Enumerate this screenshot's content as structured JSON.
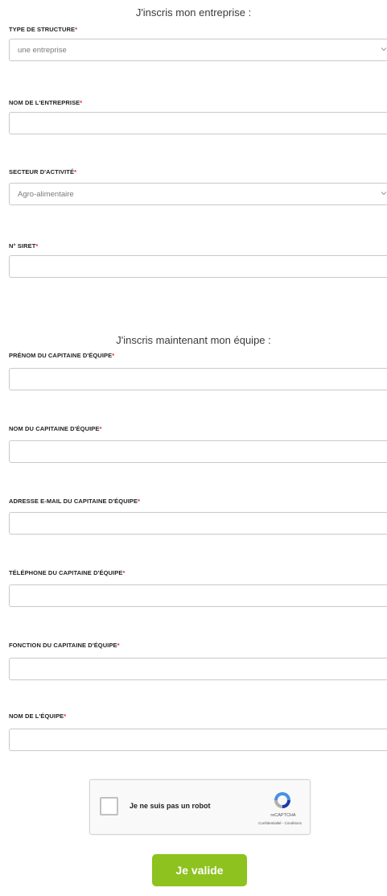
{
  "company_section": {
    "title": "J'inscris mon entreprise :",
    "structure_type": {
      "label": "TYPE DE STRUCTURE",
      "value": "une entreprise",
      "icon": "chevron-down-icon"
    },
    "company_name": {
      "label": "NOM DE L'ENTREPRISE",
      "value": ""
    },
    "sector": {
      "label": "SECTEUR D'ACTIVITÉ",
      "value": "Agro-alimentaire",
      "icon": "chevron-down-icon"
    },
    "siret": {
      "label": "N° SIRET",
      "value": ""
    }
  },
  "team_section": {
    "title": "J'inscris maintenant mon équipe :",
    "captain_firstname": {
      "label": "PRÉNOM DU CAPITAINE D'ÉQUIPE",
      "value": ""
    },
    "captain_lastname": {
      "label": "NOM DU CAPITAINE D'ÉQUIPE",
      "value": ""
    },
    "captain_email": {
      "label": "ADRESSE E-MAIL DU CAPITAINE D'ÉQUIPE",
      "value": ""
    },
    "captain_phone": {
      "label": "TÉLÉPHONE DU CAPITAINE D'ÉQUIPE",
      "value": ""
    },
    "captain_role": {
      "label": "FONCTION DU CAPITAINE D'ÉQUIPE",
      "value": ""
    },
    "team_name": {
      "label": "NOM DE L'ÉQUIPE",
      "value": ""
    }
  },
  "required_marker": "*",
  "recaptcha": {
    "checkbox_label": "Je ne suis pas un robot",
    "brand": "reCAPTCHA",
    "links": "Confidentialité - Conditions"
  },
  "submit_label": "Je valide",
  "colors": {
    "accent": "#8dc21f",
    "required": "#e0262c",
    "border": "#c9c9c9"
  }
}
